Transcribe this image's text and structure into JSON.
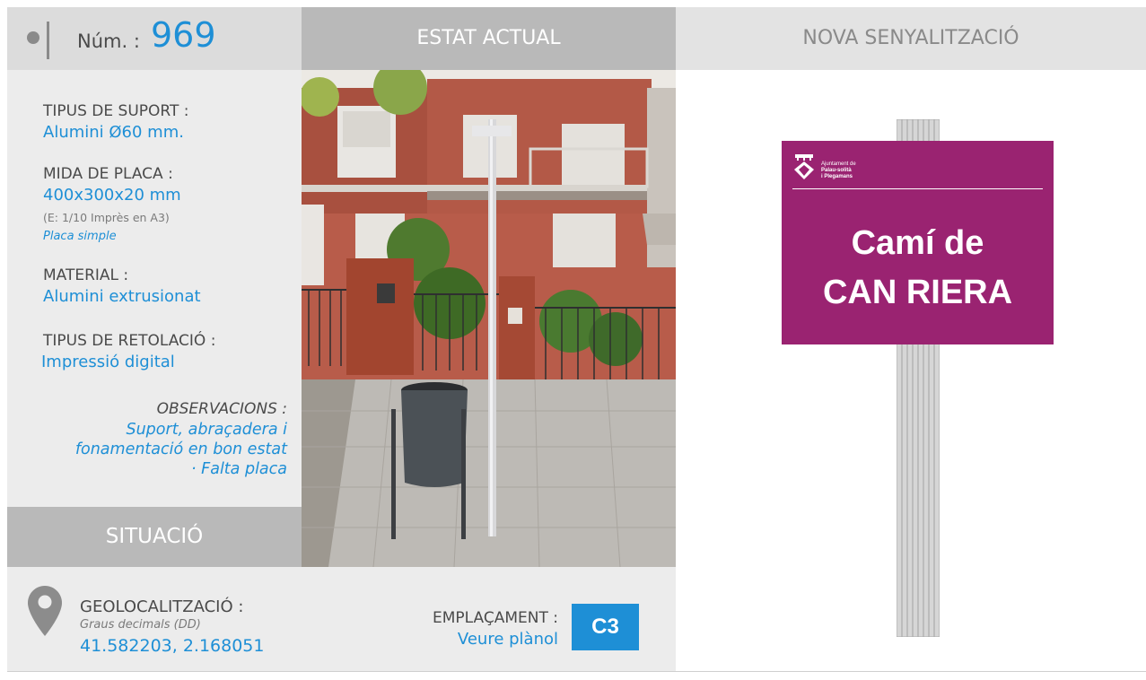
{
  "header": {
    "num_label": "Núm. :",
    "num_value": "969",
    "estat_title": "ESTAT ACTUAL",
    "nova_title": "NOVA SENYALITZACIÓ"
  },
  "specs": {
    "suport_label": "TIPUS DE SUPORT :",
    "suport_value": "Alumini Ø60 mm.",
    "placa_label": "MIDA DE PLACA :",
    "placa_value": "400x300x20 mm",
    "placa_scale": "(E: 1/10 Imprès en A3)",
    "placa_type": "Placa simple",
    "material_label": "MATERIAL :",
    "material_value": "Alumini extrusionat",
    "retolacio_label": "TIPUS DE RETOLACIÓ :",
    "retolacio_value": "Impressió digital",
    "obs_label": "OBSERVACIONS :",
    "obs_line1": "Suport, abraçadera i",
    "obs_line2": "fonamentació en bon estat",
    "obs_line3": "· Falta placa"
  },
  "situacio": {
    "title": "SITUACIÓ",
    "geo_label": "GEOLOCALITZACIÓ :",
    "geo_note": "Graus decimals (DD)",
    "geo_value": "41.582203, 2.168051",
    "empl_label": "EMPLAÇAMENT :",
    "empl_link": "Veure plànol",
    "empl_code": "C3"
  },
  "sign": {
    "logo_line1": "Ajuntament de",
    "logo_line2": "Palau-solità",
    "logo_line3": "i Plegamans",
    "line1": "Camí de",
    "line2": "CAN RIERA",
    "plate_color": "#9a2371"
  },
  "colors": {
    "accent": "#1e8fd6",
    "label_grey": "#4a4a4a"
  }
}
